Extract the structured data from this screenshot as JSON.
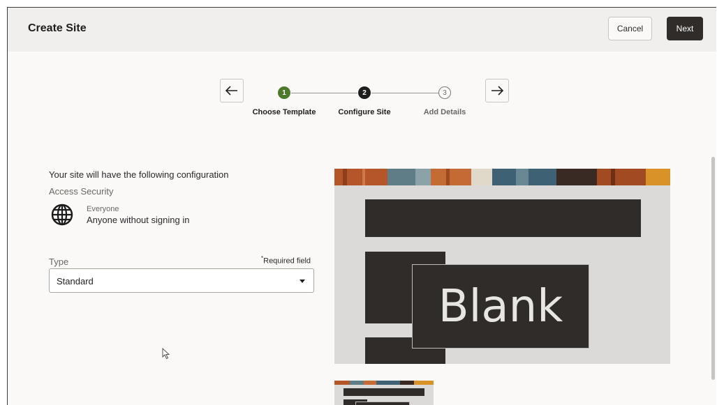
{
  "header": {
    "title": "Create Site",
    "cancel_label": "Cancel",
    "next_label": "Next"
  },
  "wizard": {
    "steps": [
      {
        "number": "1",
        "label": "Choose Template",
        "state": "complete"
      },
      {
        "number": "2",
        "label": "Configure Site",
        "state": "current"
      },
      {
        "number": "3",
        "label": "Add Details",
        "state": "upcoming"
      }
    ],
    "prev_icon": "arrow-left-icon",
    "next_icon": "arrow-right-icon"
  },
  "config": {
    "intro": "Your site will have the following configuration",
    "access_heading": "Access Security",
    "access_icon": "globe-icon",
    "access_title": "Everyone",
    "access_desc": "Anyone without signing in"
  },
  "type_field": {
    "label": "Type",
    "required_marker": "*",
    "required_text": "Required field",
    "value": "Standard"
  },
  "preview": {
    "title": "Blank"
  },
  "colors": {
    "step_complete": "#4d7a2a",
    "step_current": "#1e1e1e",
    "primary_button": "#2f2c29",
    "preview_dark": "#2f2c29"
  }
}
